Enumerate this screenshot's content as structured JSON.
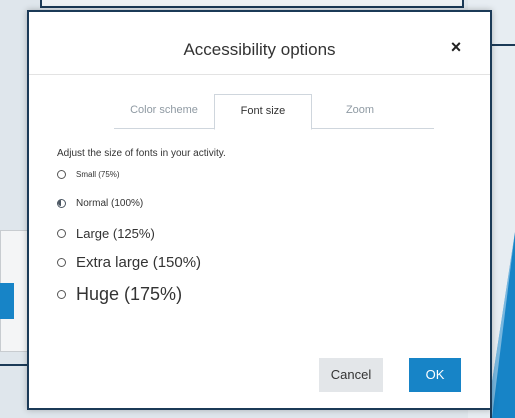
{
  "modal": {
    "title": "Accessibility options",
    "close_glyph": "×"
  },
  "tabs": [
    {
      "label": "Color scheme",
      "active": false
    },
    {
      "label": "Font size",
      "active": true
    },
    {
      "label": "Zoom",
      "active": false
    }
  ],
  "description": "Adjust the size of fonts in your activity.",
  "options": [
    {
      "label": "Small (75%)",
      "selected": false
    },
    {
      "label": "Normal (100%)",
      "selected": true
    },
    {
      "label": "Large (125%)",
      "selected": false
    },
    {
      "label": "Extra large (150%)",
      "selected": false
    },
    {
      "label": "Huge (175%)",
      "selected": false
    }
  ],
  "buttons": {
    "cancel": "Cancel",
    "ok": "OK"
  },
  "colors": {
    "accent": "#1784c7",
    "frame": "#1b3a57"
  }
}
